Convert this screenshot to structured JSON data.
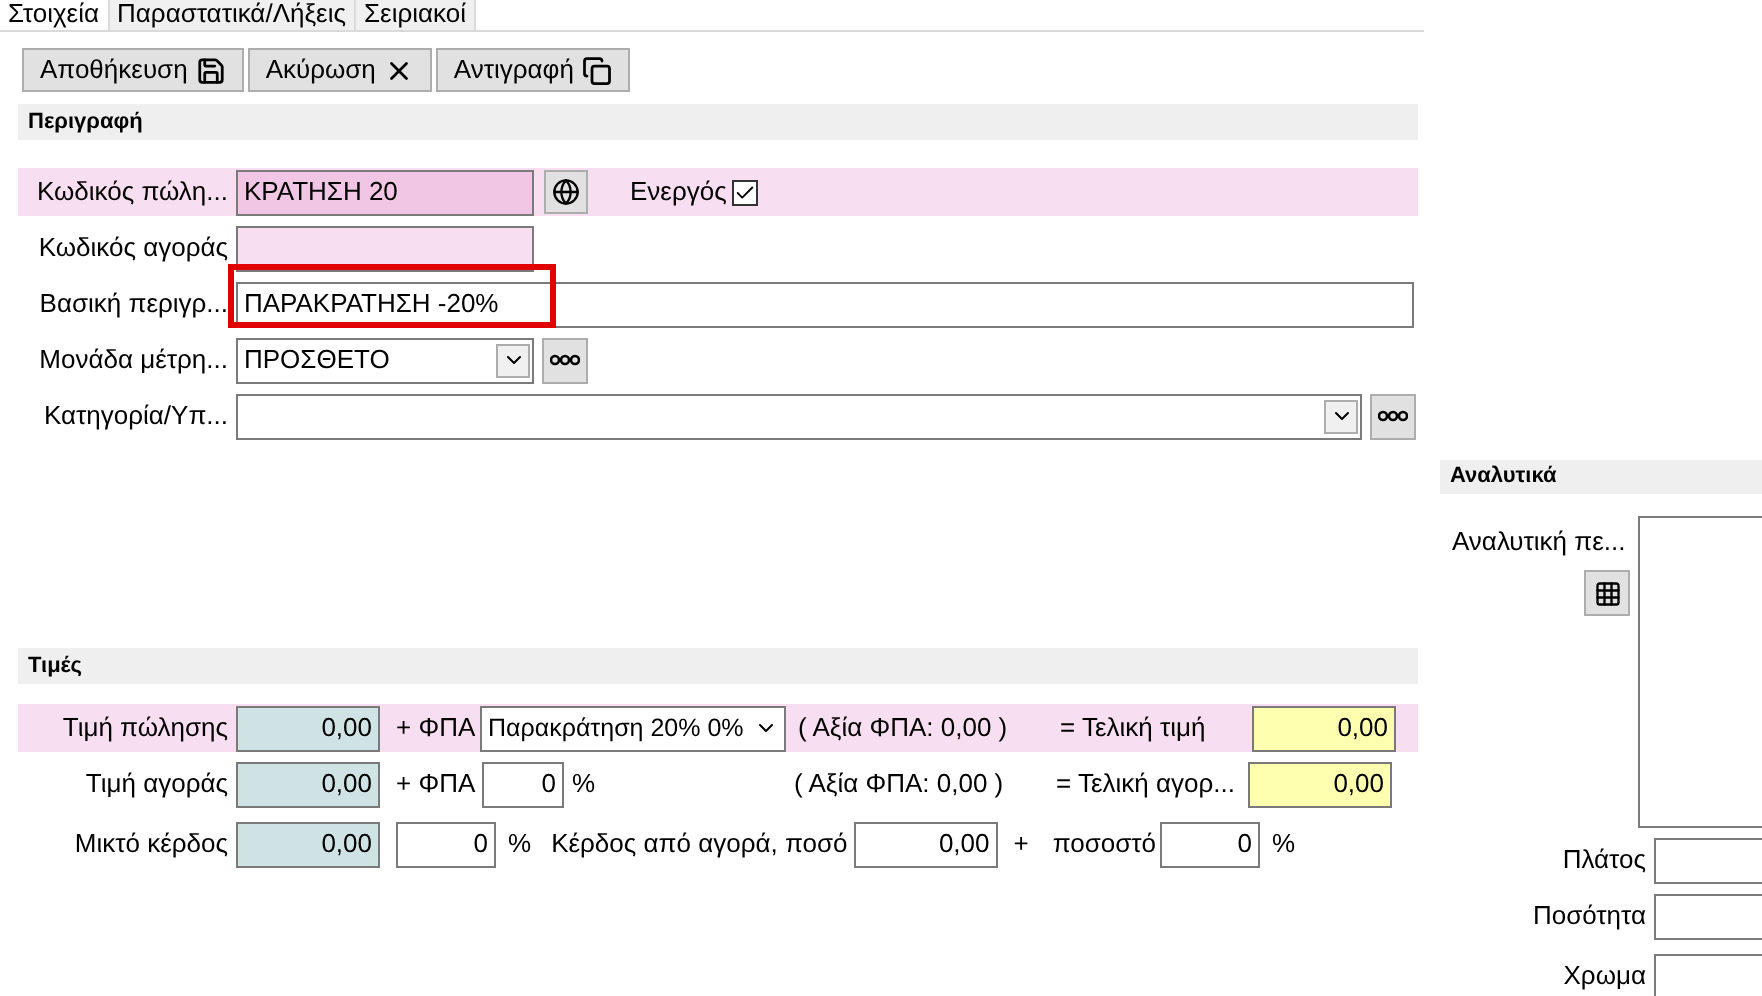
{
  "tabs": [
    {
      "label": "Στοιχεία",
      "selected": true
    },
    {
      "label": "Παραστατικά/Λήξεις",
      "selected": false
    },
    {
      "label": "Σειριακοί",
      "selected": false
    }
  ],
  "toolbar": [
    {
      "label": "Αποθήκευση",
      "kind": "save"
    },
    {
      "label": "Ακύρωση",
      "kind": "close"
    },
    {
      "label": "Αντιγραφή",
      "kind": "copy"
    }
  ],
  "description": {
    "title": "Περιγραφή",
    "sales_code": {
      "label": "Κωδικός πώλη...",
      "value": "ΚΡΑΤΗΣΗ 20"
    },
    "active": {
      "label": "Ενεργός",
      "checked": true
    },
    "purchase_code": {
      "label": "Κωδικός αγοράς"
    },
    "basic_description": {
      "label": "Βασική περιγρ...",
      "value": "ΠΑΡΑΚΡΑΤΗΣΗ -20%",
      "highlighted": true
    },
    "unit": {
      "label": "Μονάδα μέτρη...",
      "value": "ΠΡΟΣΘΕΤΟ"
    },
    "category": {
      "label": "Κατηγορία/Υπ..."
    }
  },
  "prices": {
    "title": "Τιμές",
    "sale": {
      "label": "Τιμή πώλησης",
      "value": "0,00",
      "vat_label": "+ ΦΠΑ",
      "vat": "Παρακράτηση 20% 0%",
      "vat_amount": "( Αξία ΦΠΑ: 0,00 )",
      "final_label": "= Τελική τιμή",
      "final": "0,00"
    },
    "purchase": {
      "label": "Τιμή αγοράς",
      "value": "0,00",
      "vat_label": "+ ΦΠΑ",
      "vat": "0",
      "percent": "%",
      "vat_amount": "( Αξία ΦΠΑ: 0,00 )",
      "final_label": "= Τελική αγορ...",
      "final": "0,00"
    },
    "margin": {
      "label": "Μικτό κέρδος",
      "value": "0,00",
      "rate": "0",
      "percent": "%",
      "profit_label": "Κέρδος από αγορά, ποσό",
      "profit": "0,00",
      "plus": "+",
      "share_label": "ποσοστό",
      "share": "0",
      "share_percent": "%"
    }
  },
  "details": {
    "title": "Αναλυτικά",
    "long_label": "Αναλυτική πε...",
    "fields": [
      {
        "label": "Πλάτος"
      },
      {
        "label": "Ποσότητα"
      },
      {
        "label": "Χρωμα"
      }
    ]
  }
}
